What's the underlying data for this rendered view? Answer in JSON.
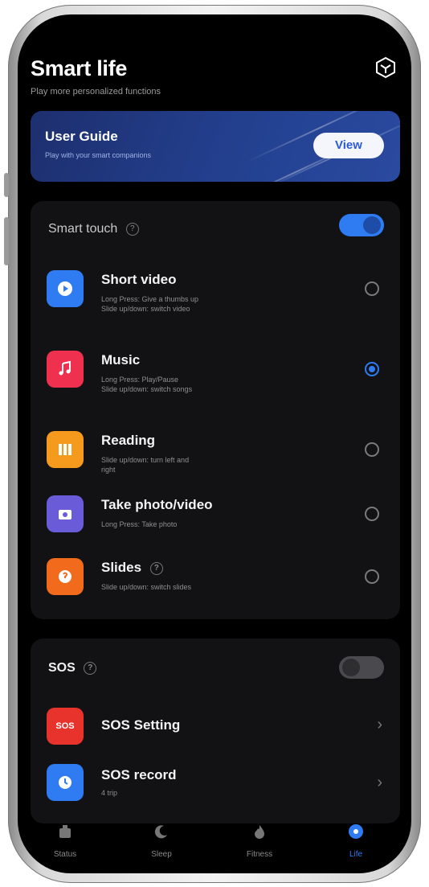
{
  "header": {
    "title": "Smart life",
    "subtitle": "Play more personalized functions"
  },
  "user_guide": {
    "title": "User Guide",
    "subtitle": "Play with your smart companions",
    "view_label": "View"
  },
  "smart_touch": {
    "label": "Smart touch",
    "help": "?",
    "enabled": true,
    "items": [
      {
        "title": "Short video",
        "subtitle": "Long Press: Give a thumbs up\nSlide up/down: switch video",
        "selected": false,
        "icon": "play-icon",
        "color": "#2f7cf2"
      },
      {
        "title": "Music",
        "subtitle": "Long Press: Play/Pause\nSlide up/down: switch songs",
        "selected": true,
        "icon": "music-note-icon",
        "color": "#f0304f"
      },
      {
        "title": "Reading",
        "subtitle": "Slide up/down: turn left and\nright",
        "selected": false,
        "icon": "book-icon",
        "color": "#f59a1c"
      },
      {
        "title": "Take photo/video",
        "subtitle": "Long Press: Take photo",
        "selected": false,
        "icon": "camera-icon",
        "color": "#6a5bd8"
      },
      {
        "title": "Slides",
        "subtitle": "Slide up/down: switch slides",
        "selected": false,
        "icon": "slides-icon",
        "color": "#f26a1c",
        "help": "?"
      }
    ]
  },
  "sos": {
    "label": "SOS",
    "help": "?",
    "enabled": false,
    "setting_label": "SOS Setting",
    "setting_icon_text": "SOS",
    "record_label": "SOS record",
    "record_sub": "4 trip",
    "chevron": "›"
  },
  "tabs": [
    {
      "label": "Status",
      "icon": "status-icon",
      "active": false
    },
    {
      "label": "Sleep",
      "icon": "moon-icon",
      "active": false
    },
    {
      "label": "Fitness",
      "icon": "flame-icon",
      "active": false
    },
    {
      "label": "Life",
      "icon": "life-icon",
      "active": true
    }
  ],
  "colors": {
    "accent": "#2f7cf2",
    "background": "#000000",
    "card": "#121215"
  }
}
